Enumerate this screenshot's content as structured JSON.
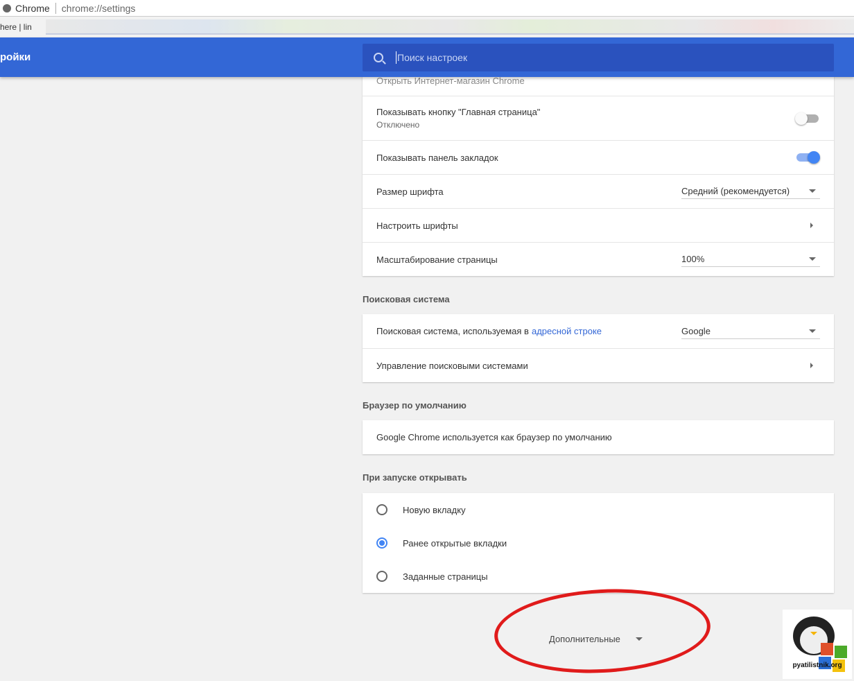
{
  "window": {
    "app": "Chrome",
    "url": "chrome://settings"
  },
  "bookmarks": {
    "visible_text": "here | lin"
  },
  "header": {
    "title": "ройки",
    "search_placeholder": "Поиск настроек"
  },
  "appearance": {
    "partial_row": "Открыть Интернет-магазин Chrome",
    "home_button": {
      "label": "Показывать кнопку \"Главная страница\"",
      "sub": "Отключено",
      "on": false
    },
    "bookmarks_bar": {
      "label": "Показывать панель закладок",
      "on": true
    },
    "font_size": {
      "label": "Размер шрифта",
      "value": "Средний (рекомендуется)"
    },
    "customize_fonts": {
      "label": "Настроить шрифты"
    },
    "zoom": {
      "label": "Масштабирование страницы",
      "value": "100%"
    }
  },
  "search_engine": {
    "title": "Поисковая система",
    "label": "Поисковая система, используемая в",
    "link": "адресной строке",
    "value": "Google",
    "manage": "Управление поисковыми системами"
  },
  "default_browser": {
    "title": "Браузер по умолчанию",
    "text": "Google Chrome используется как браузер по умолчанию"
  },
  "startup": {
    "title": "При запуске открывать",
    "options": [
      {
        "label": "Новую вкладку",
        "selected": false
      },
      {
        "label": "Ранее открытые вкладки",
        "selected": true
      },
      {
        "label": "Заданные страницы",
        "selected": false
      }
    ]
  },
  "advanced": {
    "label": "Дополнительные"
  },
  "watermark": {
    "text": "pyatilistnik.org"
  },
  "colors": {
    "header": "#3367d6",
    "accent": "#4285f4",
    "annotation": "#e01b1b"
  }
}
